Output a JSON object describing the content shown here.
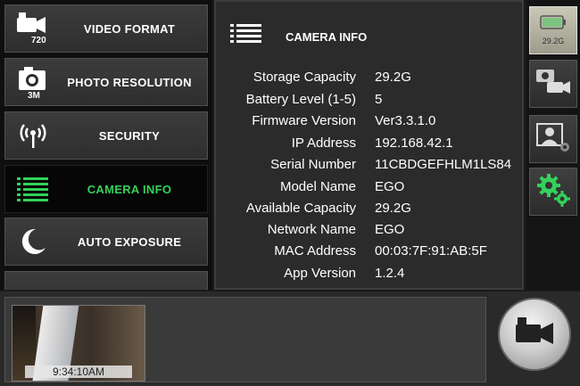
{
  "menu": {
    "items": [
      {
        "label": "VIDEO FORMAT",
        "icon": "video-720-icon",
        "badge": "720"
      },
      {
        "label": "PHOTO RESOLUTION",
        "icon": "photo-3m-icon",
        "badge": "3M"
      },
      {
        "label": "SECURITY",
        "icon": "wireless-antenna-icon"
      },
      {
        "label": "CAMERA INFO",
        "icon": "list-icon",
        "active": true
      },
      {
        "label": "AUTO EXPOSURE",
        "icon": "moon-icon"
      }
    ],
    "active_color": "#33d15a"
  },
  "panel": {
    "title": "CAMERA INFO",
    "rows": [
      {
        "label": "Storage Capacity",
        "value": "29.2G"
      },
      {
        "label": "Battery Level (1-5)",
        "value": "5"
      },
      {
        "label": "Firmware Version",
        "value": "Ver3.3.1.0"
      },
      {
        "label": "IP Address",
        "value": "192.168.42.1"
      },
      {
        "label": "Serial Number",
        "value": "11CBDGEFHLM1LS84"
      },
      {
        "label": "Model Name",
        "value": "EGO"
      },
      {
        "label": "Available Capacity",
        "value": "29.2G"
      },
      {
        "label": "Network Name",
        "value": "EGO"
      },
      {
        "label": "MAC Address",
        "value": "00:03:7F:91:AB:5F"
      },
      {
        "label": "App Version",
        "value": "1.2.4"
      }
    ]
  },
  "sidebar_right": {
    "battery_label": "29.2G",
    "buttons": [
      "battery-storage-icon",
      "photo-video-mode-icon",
      "profile-settings-icon",
      "settings-gears-icon"
    ]
  },
  "bottom": {
    "timestamp": "9:34:10AM",
    "record_icon": "video-camera-icon"
  }
}
